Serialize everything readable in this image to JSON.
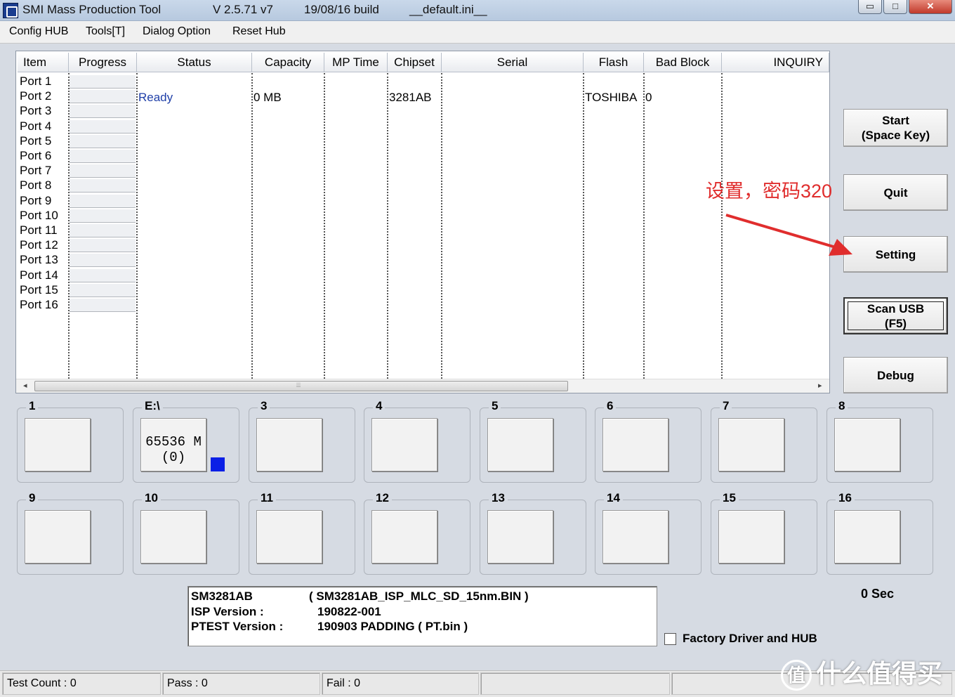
{
  "titlebar": {
    "app_title": "SMI Mass Production Tool",
    "version": "V 2.5.71   v7",
    "build": "19/08/16 build",
    "ini_file": "__default.ini__",
    "minimize": "▭",
    "maximize": "□",
    "close": "✕"
  },
  "menu": [
    "Config HUB",
    "Tools[T]",
    "Dialog Option",
    "Reset Hub"
  ],
  "list": {
    "columns": [
      "Item",
      "Progress",
      "Status",
      "Capacity",
      "MP Time",
      "Chipset",
      "Serial",
      "Flash",
      "Bad Block",
      "INQUIRY"
    ],
    "ports": [
      "Port 1",
      "Port 2",
      "Port 3",
      "Port 4",
      "Port 5",
      "Port 6",
      "Port 7",
      "Port 8",
      "Port 9",
      "Port 10",
      "Port 11",
      "Port 12",
      "Port 13",
      "Port 14",
      "Port 15",
      "Port 16"
    ],
    "row2": {
      "status": "Ready",
      "capacity": "0 MB",
      "chipset": "3281AB",
      "flash": "TOSHIBA",
      "bad_block": "0"
    },
    "scroll_grip": "⦙⦙⦙",
    "scroll_left": "◂",
    "scroll_right": "▸"
  },
  "buttons": {
    "start": "Start\n(Space Key)",
    "quit": "Quit",
    "setting": "Setting",
    "scan_usb": "Scan USB\n(F5)",
    "debug": "Debug"
  },
  "annotation": "设置，密码320",
  "port_groups": [
    {
      "label": "1",
      "text": ""
    },
    {
      "label": "E:\\",
      "text": "65536 M\n(0)",
      "indicator_color": "#0a1fe6"
    },
    {
      "label": "3",
      "text": ""
    },
    {
      "label": "4",
      "text": ""
    },
    {
      "label": "5",
      "text": ""
    },
    {
      "label": "6",
      "text": ""
    },
    {
      "label": "7",
      "text": ""
    },
    {
      "label": "8",
      "text": ""
    },
    {
      "label": "9",
      "text": ""
    },
    {
      "label": "10",
      "text": ""
    },
    {
      "label": "11",
      "text": ""
    },
    {
      "label": "12",
      "text": ""
    },
    {
      "label": "13",
      "text": ""
    },
    {
      "label": "14",
      "text": ""
    },
    {
      "label": "15",
      "text": ""
    },
    {
      "label": "16",
      "text": ""
    }
  ],
  "info": {
    "chip": "SM3281AB",
    "isp_file": "( SM3281AB_ISP_MLC_SD_15nm.BIN )",
    "isp_label": "ISP Version :",
    "isp_value": "190822-001",
    "ptest_label": "PTEST Version :",
    "ptest_value": "190903 PADDING   ( PT.bin )"
  },
  "timer": "0 Sec",
  "factory_label": "Factory Driver and HUB",
  "status": {
    "test_count": "Test Count : 0",
    "pass": "Pass : 0",
    "fail": "Fail : 0"
  },
  "watermark": {
    "logo": "值",
    "text": "什么值得买"
  },
  "colors": {
    "accent_red": "#e02d2d",
    "ready_blue": "#1f3fa8",
    "indicator_blue": "#0a1fe6"
  }
}
